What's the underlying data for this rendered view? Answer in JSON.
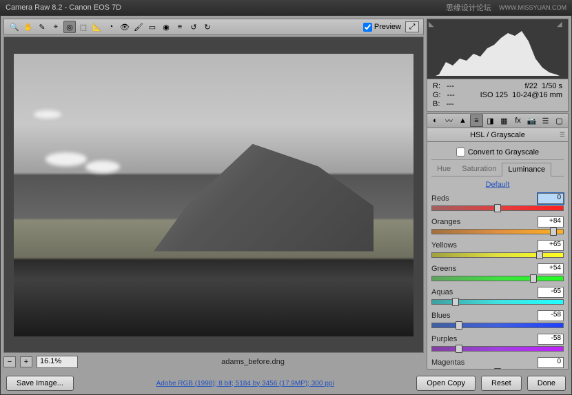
{
  "title": "Camera Raw 8.2  -  Canon EOS 7D",
  "watermark": "思缘设计论坛",
  "watermark_url": "WWW.MISSYUAN.COM",
  "toolbar": {
    "preview_label": "Preview"
  },
  "zoom": {
    "value": "16.1%"
  },
  "filename": "adams_before.dng",
  "info": {
    "r": "R:",
    "g": "G:",
    "b": "B:",
    "rv": "---",
    "gv": "---",
    "bv": "---",
    "aperture": "f/22",
    "shutter": "1/50 s",
    "iso": "ISO 125",
    "lens": "10-24@16 mm"
  },
  "panel": {
    "title": "HSL / Grayscale",
    "grayscale_label": "Convert to Grayscale",
    "tabs": {
      "hue": "Hue",
      "saturation": "Saturation",
      "luminance": "Luminance"
    },
    "default_label": "Default"
  },
  "sliders": [
    {
      "label": "Reds",
      "value": "0",
      "pos": 50,
      "grad": "linear-gradient(90deg,#a06060,#e04040,#ff2020)"
    },
    {
      "label": "Oranges",
      "value": "+84",
      "pos": 92,
      "grad": "linear-gradient(90deg,#a07040,#e09040,#ffb020)"
    },
    {
      "label": "Yellows",
      "value": "+65",
      "pos": 82,
      "grad": "linear-gradient(90deg,#a0a040,#e0e040,#ffff20)"
    },
    {
      "label": "Greens",
      "value": "+54",
      "pos": 77,
      "grad": "linear-gradient(90deg,#60a060,#40e040,#20ff20)"
    },
    {
      "label": "Aquas",
      "value": "-65",
      "pos": 18,
      "grad": "linear-gradient(90deg,#40a0a0,#40e0e0,#20ffff)"
    },
    {
      "label": "Blues",
      "value": "-58",
      "pos": 21,
      "grad": "linear-gradient(90deg,#4060a0,#4060e0,#2040ff)"
    },
    {
      "label": "Purples",
      "value": "-58",
      "pos": 21,
      "grad": "linear-gradient(90deg,#8040a0,#a040e0,#c020ff)"
    },
    {
      "label": "Magentas",
      "value": "0",
      "pos": 50,
      "grad": "linear-gradient(90deg,#a04080,#e040a0,#ff20c0)"
    }
  ],
  "footer": {
    "save": "Save Image...",
    "link": "Adobe RGB (1998); 8 bit; 5184 by 3456 (17.9MP); 300 ppi",
    "open": "Open Copy",
    "reset": "Reset",
    "done": "Done"
  }
}
